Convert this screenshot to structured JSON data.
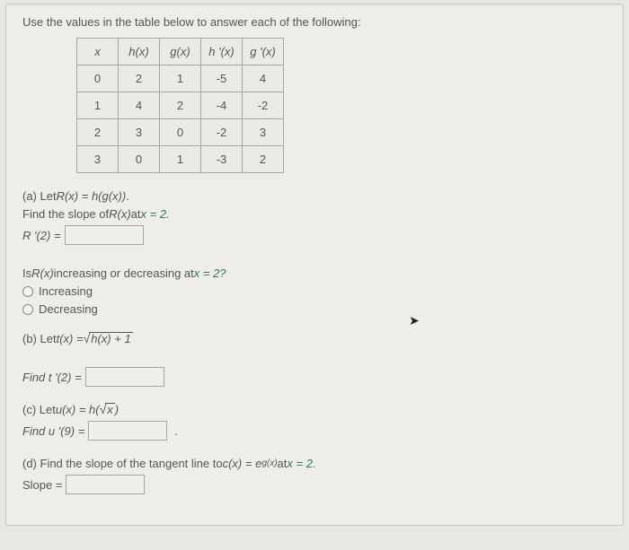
{
  "intro": "Use the values in the table below to answer each of the following:",
  "table": {
    "headers": [
      "x",
      "h(x)",
      "g(x)",
      "h '(x)",
      "g '(x)"
    ],
    "rows": [
      [
        "0",
        "2",
        "1",
        "-5",
        "4"
      ],
      [
        "1",
        "4",
        "2",
        "-4",
        "-2"
      ],
      [
        "2",
        "3",
        "0",
        "-2",
        "3"
      ],
      [
        "3",
        "0",
        "1",
        "-3",
        "2"
      ]
    ]
  },
  "a": {
    "label": "(a) Let ",
    "def_pre": "R(x) = h(g(x))",
    "def_post": ".",
    "find_pre": "Find the slope of ",
    "find_mid": "R(x)",
    "find_at": " at ",
    "find_val": "x = 2.",
    "ans_lhs": "R '(2) =",
    "q2_pre": "Is ",
    "q2_mid": "R(x)",
    "q2_post": " increasing or decreasing at ",
    "q2_val": "x = 2?",
    "opt1": "Increasing",
    "opt2": "Decreasing"
  },
  "b": {
    "label": "(b) Let  ",
    "lhs": "t(x) = ",
    "under": "h(x) + 1",
    "find_lhs": "Find t '(2) ="
  },
  "c": {
    "label": "(c) Let  ",
    "lhs": "u(x) = h(",
    "under": "x",
    "rparen": ")",
    "find_lhs": "Find u '(9) ="
  },
  "d": {
    "label": "(d) Find the slope of the tangent line to  ",
    "lhs": "c(x) = e",
    "exp": "g(x)",
    "at": "  at ",
    "val": "x = 2.",
    "ans_lhs": "Slope ="
  },
  "chart_data": {
    "type": "table",
    "columns": [
      "x",
      "h(x)",
      "g(x)",
      "h'(x)",
      "g'(x)"
    ],
    "rows": [
      {
        "x": 0,
        "h": 2,
        "g": 1,
        "hp": -5,
        "gp": 4
      },
      {
        "x": 1,
        "h": 4,
        "g": 2,
        "hp": -4,
        "gp": -2
      },
      {
        "x": 2,
        "h": 3,
        "g": 0,
        "hp": -2,
        "gp": 3
      },
      {
        "x": 3,
        "h": 0,
        "g": 1,
        "hp": -3,
        "gp": 2
      }
    ]
  }
}
